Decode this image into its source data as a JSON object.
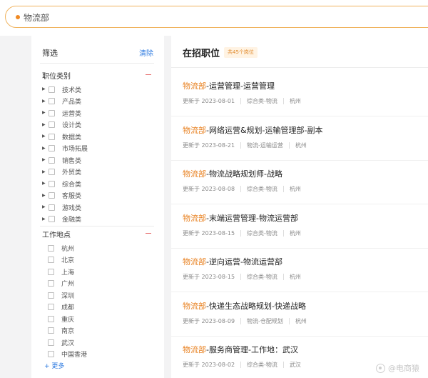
{
  "search": {
    "query": "物流部"
  },
  "filter": {
    "title": "筛选",
    "clear_label": "清除",
    "categories_title": "职位类别",
    "categories": [
      "技术类",
      "产品类",
      "运营类",
      "设计类",
      "数据类",
      "市场拓展",
      "销售类",
      "外贸类",
      "综合类",
      "客服类",
      "游戏类",
      "金融类"
    ],
    "locations_title": "工作地点",
    "locations": [
      "杭州",
      "北京",
      "上海",
      "广州",
      "深圳",
      "成都",
      "重庆",
      "南京",
      "武汉",
      "中国香港"
    ],
    "more_label": "+ 更多"
  },
  "list": {
    "title": "在招职位",
    "count_badge": "共45个岗位",
    "jobs": [
      {
        "dept": "物流部",
        "rest": "-运营管理-运营管理",
        "date": "更新于 2023-08-01",
        "cat": "综合类-物流",
        "city": "杭州"
      },
      {
        "dept": "物流部",
        "rest": "-网络运营&规划-运输管理部-副本",
        "date": "更新于 2023-08-21",
        "cat": "物流-运输运营",
        "city": "杭州"
      },
      {
        "dept": "物流部",
        "rest": "-物流战略规划师-战略",
        "date": "更新于 2023-08-08",
        "cat": "综合类-物流",
        "city": "杭州"
      },
      {
        "dept": "物流部",
        "rest": "-末端运营管理-物流运营部",
        "date": "更新于 2023-08-15",
        "cat": "综合类-物流",
        "city": "杭州"
      },
      {
        "dept": "物流部",
        "rest": "-逆向运营-物流运营部",
        "date": "更新于 2023-08-15",
        "cat": "综合类-物流",
        "city": "杭州"
      },
      {
        "dept": "物流部",
        "rest": "-快递生态战略规划-快递战略",
        "date": "更新于 2023-08-09",
        "cat": "物流-仓配规划",
        "city": "杭州"
      },
      {
        "dept": "物流部",
        "rest": "-服务商管理-工作地：武汉",
        "date": "更新于 2023-08-02",
        "cat": "综合类-物流",
        "city": "武汉"
      }
    ]
  },
  "watermark": "@电商猿"
}
